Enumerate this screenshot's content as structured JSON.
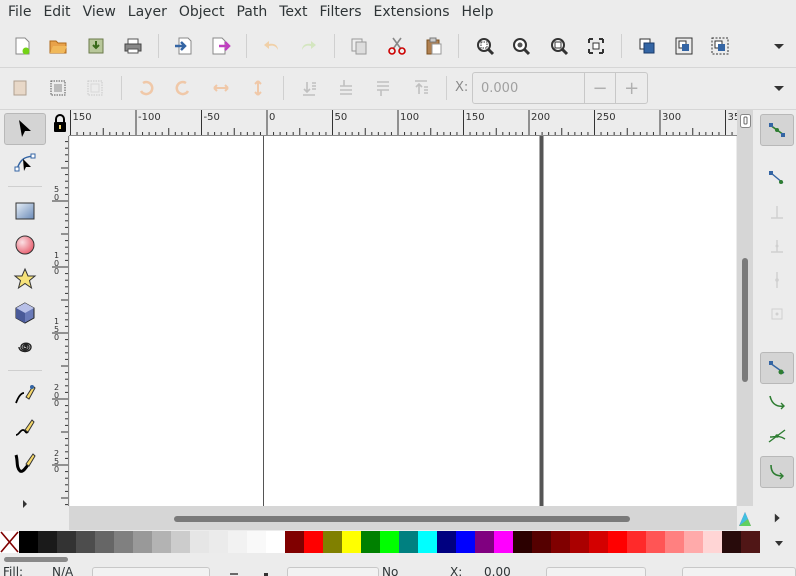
{
  "menu": {
    "items": [
      "File",
      "Edit",
      "View",
      "Layer",
      "Object",
      "Path",
      "Text",
      "Filters",
      "Extensions",
      "Help"
    ]
  },
  "toolbar": {
    "commands": [
      "new-document-icon",
      "open-icon",
      "save-icon",
      "print-icon",
      "import-icon",
      "export-icon",
      "undo-icon",
      "redo-icon",
      "copy-icon",
      "cut-icon",
      "paste-icon",
      "zoom-selection-icon",
      "zoom-drawing-icon",
      "zoom-page-icon",
      "zoom-fit-icon",
      "duplicate-icon",
      "group-icon",
      "ungroup-icon"
    ]
  },
  "controls": {
    "x_label": "X:",
    "x_value": "0.000",
    "minus": "−",
    "plus": "+"
  },
  "rulers": {
    "horizontal_labels": [
      "150",
      "-100",
      "-50",
      "0",
      "50",
      "100",
      "150",
      "200",
      "250",
      "300",
      "35"
    ],
    "vertical_labels": [
      "5 0",
      "1 0 0",
      "1 5 0",
      "2 0 0",
      "2 5 0"
    ]
  },
  "palette": {
    "colors": [
      "#000000",
      "#1a1a1a",
      "#333333",
      "#4d4d4d",
      "#666666",
      "#808080",
      "#999999",
      "#b3b3b3",
      "#cccccc",
      "#e6e6e6",
      "#ebebeb",
      "#f2f2f2",
      "#f9f9f9",
      "#ffffff",
      "#800000",
      "#ff0000",
      "#808000",
      "#ffff00",
      "#008000",
      "#00ff00",
      "#008080",
      "#00ffff",
      "#000080",
      "#0000ff",
      "#800080",
      "#ff00ff",
      "#2b0000",
      "#550000",
      "#800000",
      "#aa0000",
      "#d40000",
      "#ff0000",
      "#ff2a2a",
      "#ff5555",
      "#ff8080",
      "#ffaaaa",
      "#ffd5d5",
      "#280b0b",
      "#501616"
    ]
  },
  "status": {
    "fill_label": "Fill:",
    "fill_value": "N/A",
    "selection_text": "No",
    "x_label": "X:",
    "x_value": "0.00"
  },
  "colors": {
    "accent_green": "#2e7d32",
    "icon_blue": "#3465a4",
    "page_border": "#555555"
  }
}
